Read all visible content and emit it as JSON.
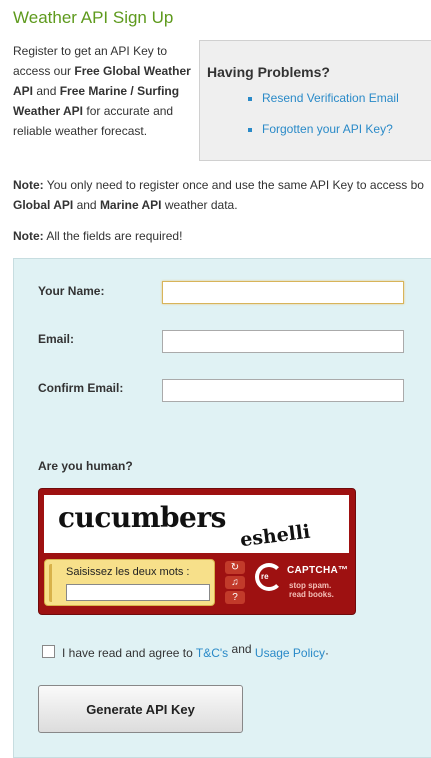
{
  "page": {
    "title": "Weather API Sign Up",
    "intro": {
      "p1": "Register to get an API Key to access our ",
      "b1": "Free Global Weather API",
      "p2": " and ",
      "b2": "Free Marine / Surfing Weather API",
      "p3": " for accurate and reliable weather forecast."
    },
    "problems": {
      "heading": "Having Problems?",
      "links": [
        "Resend Verification Email",
        "Forgotten your API Key?"
      ]
    },
    "note1": {
      "label": "Note:",
      "text1": " You only need to register once and use the same API Key to access bo",
      "b1": "Global API",
      "text2": " and ",
      "b2": "Marine API",
      "text3": " weather data."
    },
    "note2": {
      "label": "Note:",
      "text": " All the fields are required!"
    }
  },
  "form": {
    "name_label": "Your Name:",
    "name_value": "",
    "email_label": "Email:",
    "email_value": "",
    "confirm_label": "Confirm Email:",
    "confirm_value": "",
    "human_label": "Are you human?",
    "captcha": {
      "word1": "cucumbers",
      "word2": "eshelli",
      "prompt": "Saisissez les deux mots :",
      "value": "",
      "brand_re": "re",
      "brand": "CAPTCHA™",
      "tagline1": "stop spam.",
      "tagline2": "read books."
    },
    "agree": {
      "text": "I have read and agree to ",
      "link1": "T&C's",
      "and": "and",
      "link2": "Usage Policy",
      "suffix": "·"
    },
    "submit_label": "Generate API Key"
  }
}
